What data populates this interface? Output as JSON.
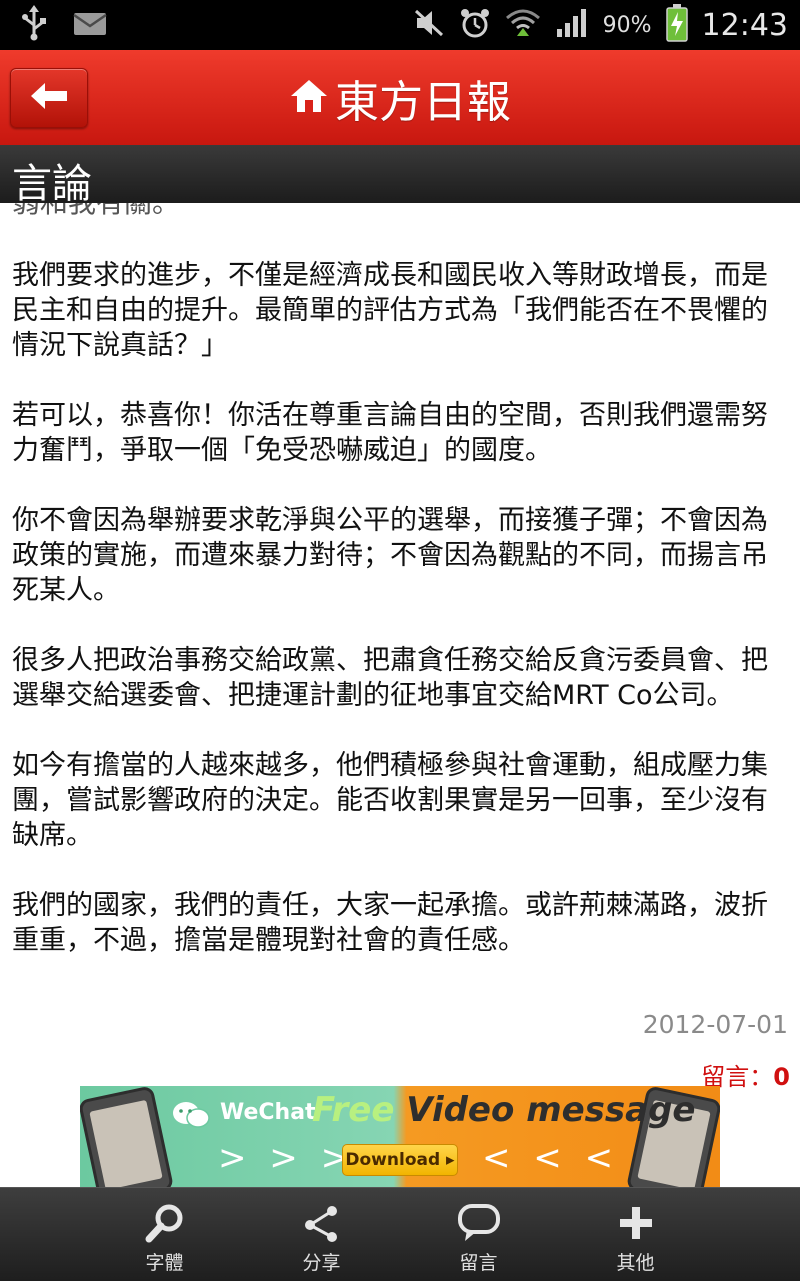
{
  "status_bar": {
    "battery_percent": "90%",
    "time": "12:43",
    "icons": [
      "usb-icon",
      "mail-icon",
      "mute-icon",
      "alarm-icon",
      "wifi-icon",
      "signal-icon",
      "battery-charging-icon"
    ]
  },
  "app_bar": {
    "title": "東方日報",
    "back_icon": "back-arrow-icon",
    "home_icon": "home-icon"
  },
  "section": {
    "title": "言論"
  },
  "article": {
    "cut_off_line": "弱和我有關。",
    "paragraphs": [
      "我們要求的進步，不僅是經濟成長和國民收入等財政增長，而是民主和自由的提升。最簡單的評估方式為「我們能否在不畏懼的情況下說真話？」",
      "若可以，恭喜你！你活在尊重言論自由的空間，否則我們還需努力奮鬥，爭取一個「免受恐嚇威迫」的國度。",
      "你不會因為舉辦要求乾淨與公平的選舉，而接獲子彈；不會因為政策的實施，而遭來暴力對待；不會因為觀點的不同，而揚言吊死某人。",
      "很多人把政治事務交給政黨、把肅貪任務交給反貪污委員會、把選舉交給選委會、把捷運計劃的征地事宜交給MRT Co公司。",
      "如今有擔當的人越來越多，他們積極參與社會運動，組成壓力集團，嘗試影響政府的決定。能否收割果實是另一回事，至少沒有缺席。",
      "我們的國家，我們的責任，大家一起承擔。或許荊棘滿路，波折重重，不過，擔當是體現對社會的責任感。"
    ],
    "date": "2012-07-01",
    "comment_label": "留言：",
    "comment_count": "0"
  },
  "ad": {
    "brand": "WeChat",
    "headline_free": "Free",
    "headline_rest": " Video message",
    "cta": "Download ▸",
    "arrows_left": "> > >",
    "arrows_right": "< < <",
    "colors": {
      "left": "#6cc9a0",
      "right": "#f28c16"
    }
  },
  "bottom_nav": {
    "items": [
      {
        "label": "字體",
        "icon": "search-icon"
      },
      {
        "label": "分享",
        "icon": "share-icon"
      },
      {
        "label": "留言",
        "icon": "comment-icon"
      },
      {
        "label": "其他",
        "icon": "plus-icon"
      }
    ]
  },
  "colors": {
    "brand_red": "#e2261b",
    "section_bar": "#2a2a2a",
    "date_gray": "#8a8a8a",
    "comment_red": "#d01010"
  }
}
